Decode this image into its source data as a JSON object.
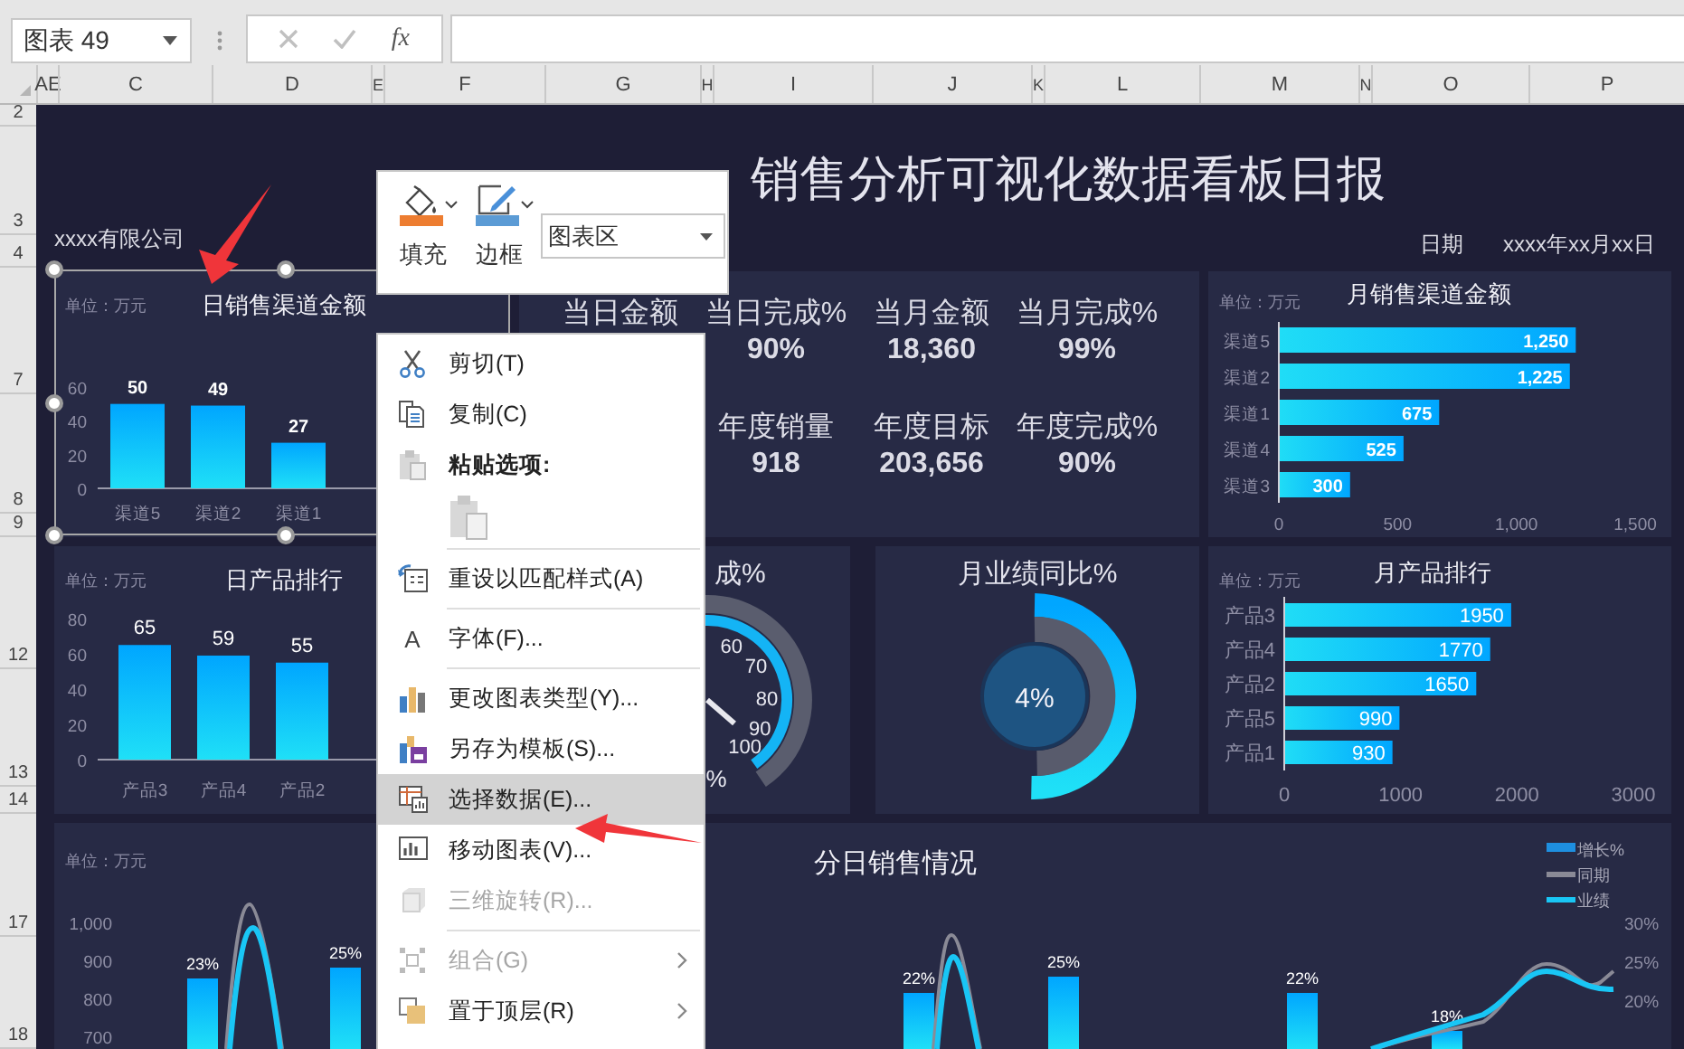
{
  "formula_bar": {
    "name_box": "图表 49",
    "function_label": "fx"
  },
  "columns": [
    "AE",
    "C",
    "D",
    "E",
    "F",
    "G",
    "H",
    "I",
    "J",
    "K",
    "L",
    "M",
    "N",
    "O",
    "P"
  ],
  "rows": [
    "2",
    "3",
    "4",
    "7",
    "8",
    "9",
    "12",
    "13",
    "14",
    "17",
    "18"
  ],
  "dashboard": {
    "title": "销售分析可视化数据看板日报",
    "company": "xxxx有限公司",
    "date_label": "日期",
    "date_value": "xxxx年xx月xx日"
  },
  "daily_channel_chart": {
    "chart_data": {
      "type": "bar",
      "title": "日销售渠道金额",
      "ylabel": "单位：万元",
      "categories": [
        "渠道5",
        "渠道2",
        "渠道1"
      ],
      "values": [
        50,
        49,
        27
      ],
      "ylim": [
        0,
        60
      ],
      "yticks": [
        0,
        20,
        40,
        60
      ],
      "data_labels": true
    }
  },
  "kpi_rows": [
    {
      "items": [
        {
          "label": "当日金额"
        },
        {
          "label": "当日完成%",
          "value": "90%"
        },
        {
          "label": "当月金额",
          "value": "18,360"
        },
        {
          "label": "当月完成%",
          "value": "99%"
        }
      ]
    },
    {
      "items": [
        {
          "label": "年度销量",
          "value": "918"
        },
        {
          "label": "年度目标",
          "value": "203,656"
        },
        {
          "label": "年度完成%",
          "value": "90%"
        }
      ]
    }
  ],
  "monthly_channel_chart": {
    "chart_data": {
      "type": "bar",
      "orientation": "horizontal",
      "title": "月销售渠道金额",
      "ylabel": "单位：万元",
      "categories": [
        "渠道5",
        "渠道2",
        "渠道1",
        "渠道4",
        "渠道3"
      ],
      "values": [
        1250,
        1225,
        675,
        525,
        300
      ],
      "xlim": [
        0,
        1500
      ],
      "xticks": [
        0,
        500,
        {
          "value": 1000,
          "label": "1,000"
        },
        {
          "value": 1500,
          "label": "1,500"
        }
      ],
      "value_labels": [
        "1,250",
        "1,225",
        "675",
        "525",
        "300"
      ]
    }
  },
  "daily_product_chart": {
    "chart_data": {
      "type": "bar",
      "title": "日产品排行",
      "ylabel": "单位：万元",
      "categories": [
        "产品3",
        "产品4",
        "产品2"
      ],
      "values": [
        65,
        59,
        55
      ],
      "ylim": [
        0,
        80
      ],
      "yticks": [
        0,
        20,
        40,
        60,
        80
      ],
      "data_labels": true
    }
  },
  "gauge": {
    "title": "成%",
    "ticks": [
      "60",
      "70",
      "80",
      "90",
      "100"
    ],
    "reading": "%"
  },
  "yoy": {
    "title": "月业绩同比%",
    "reading": "4%"
  },
  "monthly_product_chart": {
    "chart_data": {
      "type": "bar",
      "orientation": "horizontal",
      "title": "月产品排行",
      "ylabel": "单位：万元",
      "categories": [
        "产品3",
        "产品4",
        "产品2",
        "产品5",
        "产品1"
      ],
      "values": [
        1950,
        1770,
        1650,
        990,
        930
      ],
      "xlim": [
        0,
        3000
      ],
      "xticks": [
        0,
        1000,
        2000,
        3000
      ],
      "data_labels": true
    }
  },
  "daily_sales": {
    "title": "分日销售情况",
    "unit": "单位：万元",
    "left_ticks": [
      "1,000",
      "900",
      "800",
      "700"
    ],
    "right_ticks": [
      "30%",
      "25%",
      "20%"
    ],
    "bar_labels": [
      "23%",
      "25%",
      "22%",
      "25%",
      "22%",
      "18%"
    ],
    "legend": [
      {
        "label": "增长%",
        "kind": "bar",
        "color": "#1e8fe0"
      },
      {
        "label": "同期",
        "kind": "line",
        "color": "#8a8a96"
      },
      {
        "label": "业绩",
        "kind": "line",
        "color": "#19c6f5"
      }
    ]
  },
  "mini_toolbar": {
    "fill_label": "填充",
    "border_label": "边框",
    "element_select": "图表区"
  },
  "context_menu": [
    {
      "kind": "command",
      "label": "剪切(T)",
      "selected": false,
      "disabled": false,
      "submenu": false
    },
    {
      "kind": "command",
      "label": "复制(C)",
      "selected": false,
      "disabled": false,
      "submenu": false
    },
    {
      "kind": "heading",
      "label": "粘贴选项:"
    },
    {
      "kind": "paste-option",
      "disabled": true
    },
    {
      "kind": "divider"
    },
    {
      "kind": "command",
      "label": "重设以匹配样式(A)",
      "selected": false,
      "disabled": false,
      "submenu": false
    },
    {
      "kind": "divider"
    },
    {
      "kind": "command",
      "label": "字体(F)...",
      "glyph": "A",
      "selected": false,
      "disabled": false,
      "submenu": false
    },
    {
      "kind": "divider"
    },
    {
      "kind": "command",
      "label": "更改图表类型(Y)...",
      "selected": false,
      "disabled": false,
      "submenu": false
    },
    {
      "kind": "command",
      "label": "另存为模板(S)...",
      "selected": false,
      "disabled": false,
      "submenu": false
    },
    {
      "kind": "command",
      "label": "选择数据(E)...",
      "selected": true,
      "disabled": false,
      "submenu": false
    },
    {
      "kind": "command",
      "label": "移动图表(V)...",
      "selected": false,
      "disabled": false,
      "submenu": false
    },
    {
      "kind": "command",
      "label": "三维旋转(R)...",
      "selected": false,
      "disabled": true,
      "submenu": false
    },
    {
      "kind": "divider"
    },
    {
      "kind": "command",
      "label": "组合(G)",
      "selected": false,
      "disabled": true,
      "submenu": true
    },
    {
      "kind": "command",
      "label": "置于顶层(R)",
      "selected": false,
      "disabled": false,
      "submenu": true
    }
  ]
}
